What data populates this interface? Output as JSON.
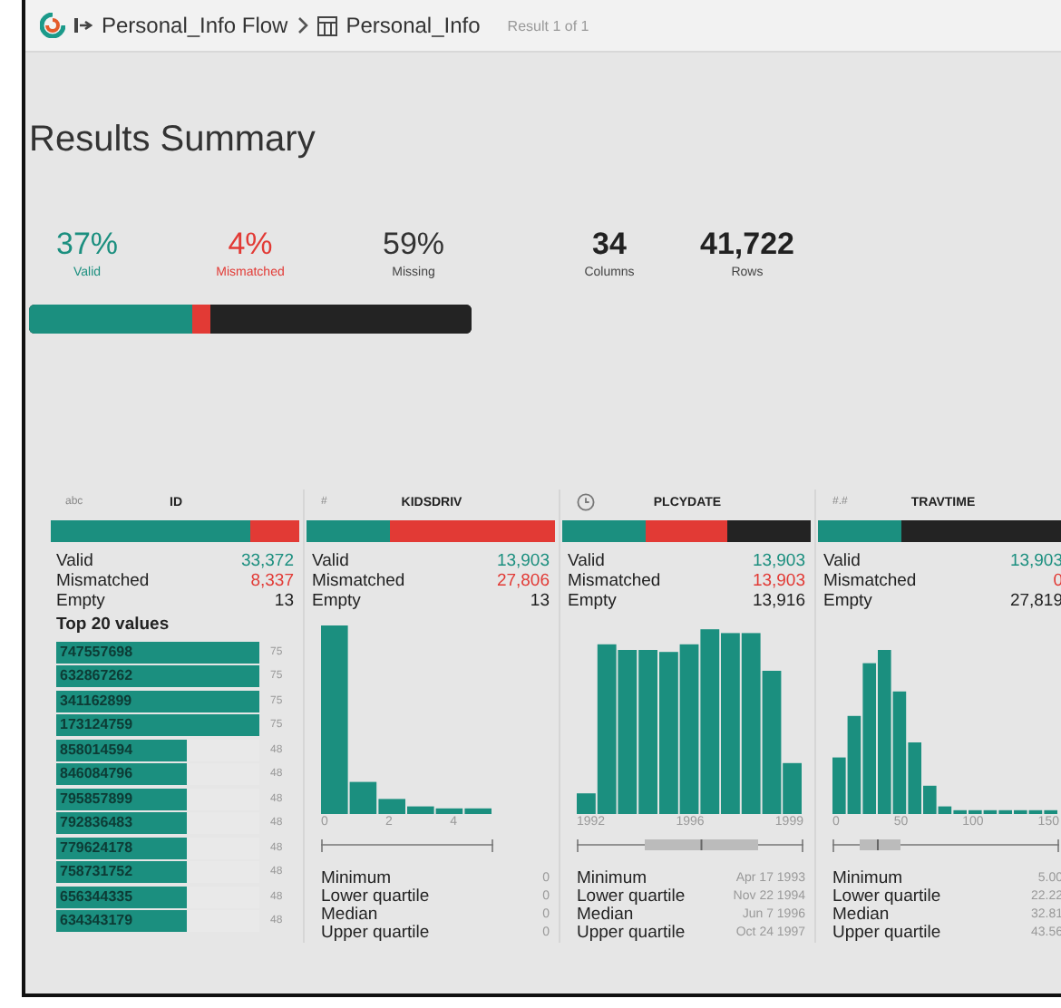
{
  "breadcrumb": {
    "flow": "Personal_Info Flow",
    "dataset": "Personal_Info",
    "result": "Result 1 of 1"
  },
  "title": "Results Summary",
  "summary": {
    "stats": [
      {
        "kind": "valid",
        "value": "37%",
        "label": "Valid"
      },
      {
        "kind": "mismatched",
        "value": "4%",
        "label": "Mismatched"
      },
      {
        "kind": "missing",
        "value": "59%",
        "label": "Missing"
      },
      {
        "kind": "count",
        "value": "34",
        "label": "Columns"
      },
      {
        "kind": "count",
        "value": "41,722",
        "label": "Rows"
      }
    ]
  },
  "columns": [
    {
      "name": "ID",
      "kind": "text",
      "type_label": "abc",
      "counts": [
        {
          "kind": "valid",
          "label": "Valid",
          "value": "33,372"
        },
        {
          "kind": "mismatched",
          "label": "Mismatched",
          "value": "8,337"
        },
        {
          "kind": "missing",
          "label": "Empty",
          "value": "13"
        }
      ],
      "top_values": {
        "title": "Top 20 values",
        "items": [
          {
            "value": "747557698",
            "count": "75",
            "level": 1
          },
          {
            "value": "632867262",
            "count": "75",
            "level": 1
          },
          {
            "value": "341162899",
            "count": "75",
            "level": 1
          },
          {
            "value": "173124759",
            "count": "75",
            "level": 1
          },
          {
            "value": "858014594",
            "count": "48",
            "level": 0.64
          },
          {
            "value": "846084796",
            "count": "48",
            "level": 0.64
          },
          {
            "value": "795857899",
            "count": "48",
            "level": 0.64
          },
          {
            "value": "792836483",
            "count": "48",
            "level": 0.64
          },
          {
            "value": "779624178",
            "count": "48",
            "level": 0.64
          },
          {
            "value": "758731752",
            "count": "48",
            "level": 0.64
          },
          {
            "value": "656344335",
            "count": "48",
            "level": 0.64
          },
          {
            "value": "634343179",
            "count": "48",
            "level": 0.64
          }
        ]
      }
    },
    {
      "name": "KIDSDRIV",
      "kind": "number",
      "type_label": "#",
      "counts": [
        {
          "kind": "valid",
          "label": "Valid",
          "value": "13,903"
        },
        {
          "kind": "mismatched",
          "label": "Mismatched",
          "value": "27,806"
        },
        {
          "kind": "missing",
          "label": "Empty",
          "value": "13"
        }
      ],
      "histogram": {
        "ticks": [
          "0",
          "2",
          "4"
        ]
      },
      "quartiles": [
        {
          "label": "Minimum",
          "value": "0"
        },
        {
          "label": "Lower quartile",
          "value": "0"
        },
        {
          "label": "Median",
          "value": "0"
        },
        {
          "label": "Upper quartile",
          "value": "0"
        }
      ]
    },
    {
      "name": "PLCYDATE",
      "kind": "date",
      "counts": [
        {
          "kind": "valid",
          "label": "Valid",
          "value": "13,903"
        },
        {
          "kind": "mismatched",
          "label": "Mismatched",
          "value": "13,903"
        },
        {
          "kind": "missing",
          "label": "Empty",
          "value": "13,916"
        }
      ],
      "histogram": {
        "ticks": [
          "1992",
          "1996",
          "1999"
        ]
      },
      "quartiles": [
        {
          "label": "Minimum",
          "value": "Apr 17 1993"
        },
        {
          "label": "Lower quartile",
          "value": "Nov 22 1994"
        },
        {
          "label": "Median",
          "value": "Jun 7 1996"
        },
        {
          "label": "Upper quartile",
          "value": "Oct 24 1997"
        }
      ]
    },
    {
      "name": "TRAVTIME",
      "kind": "number",
      "type_label": "#.#",
      "counts": [
        {
          "kind": "valid",
          "label": "Valid",
          "value": "13,903"
        },
        {
          "kind": "mismatched",
          "label": "Mismatched",
          "value": "0"
        },
        {
          "kind": "missing",
          "label": "Empty",
          "value": "27,819"
        }
      ],
      "histogram": {
        "ticks": [
          "0",
          "50",
          "100",
          "150"
        ]
      },
      "quartiles": [
        {
          "label": "Minimum",
          "value": "5.00"
        },
        {
          "label": "Lower quartile",
          "value": "22.22"
        },
        {
          "label": "Median",
          "value": "32.81"
        },
        {
          "label": "Upper quartile",
          "value": "43.56"
        }
      ]
    }
  ]
}
